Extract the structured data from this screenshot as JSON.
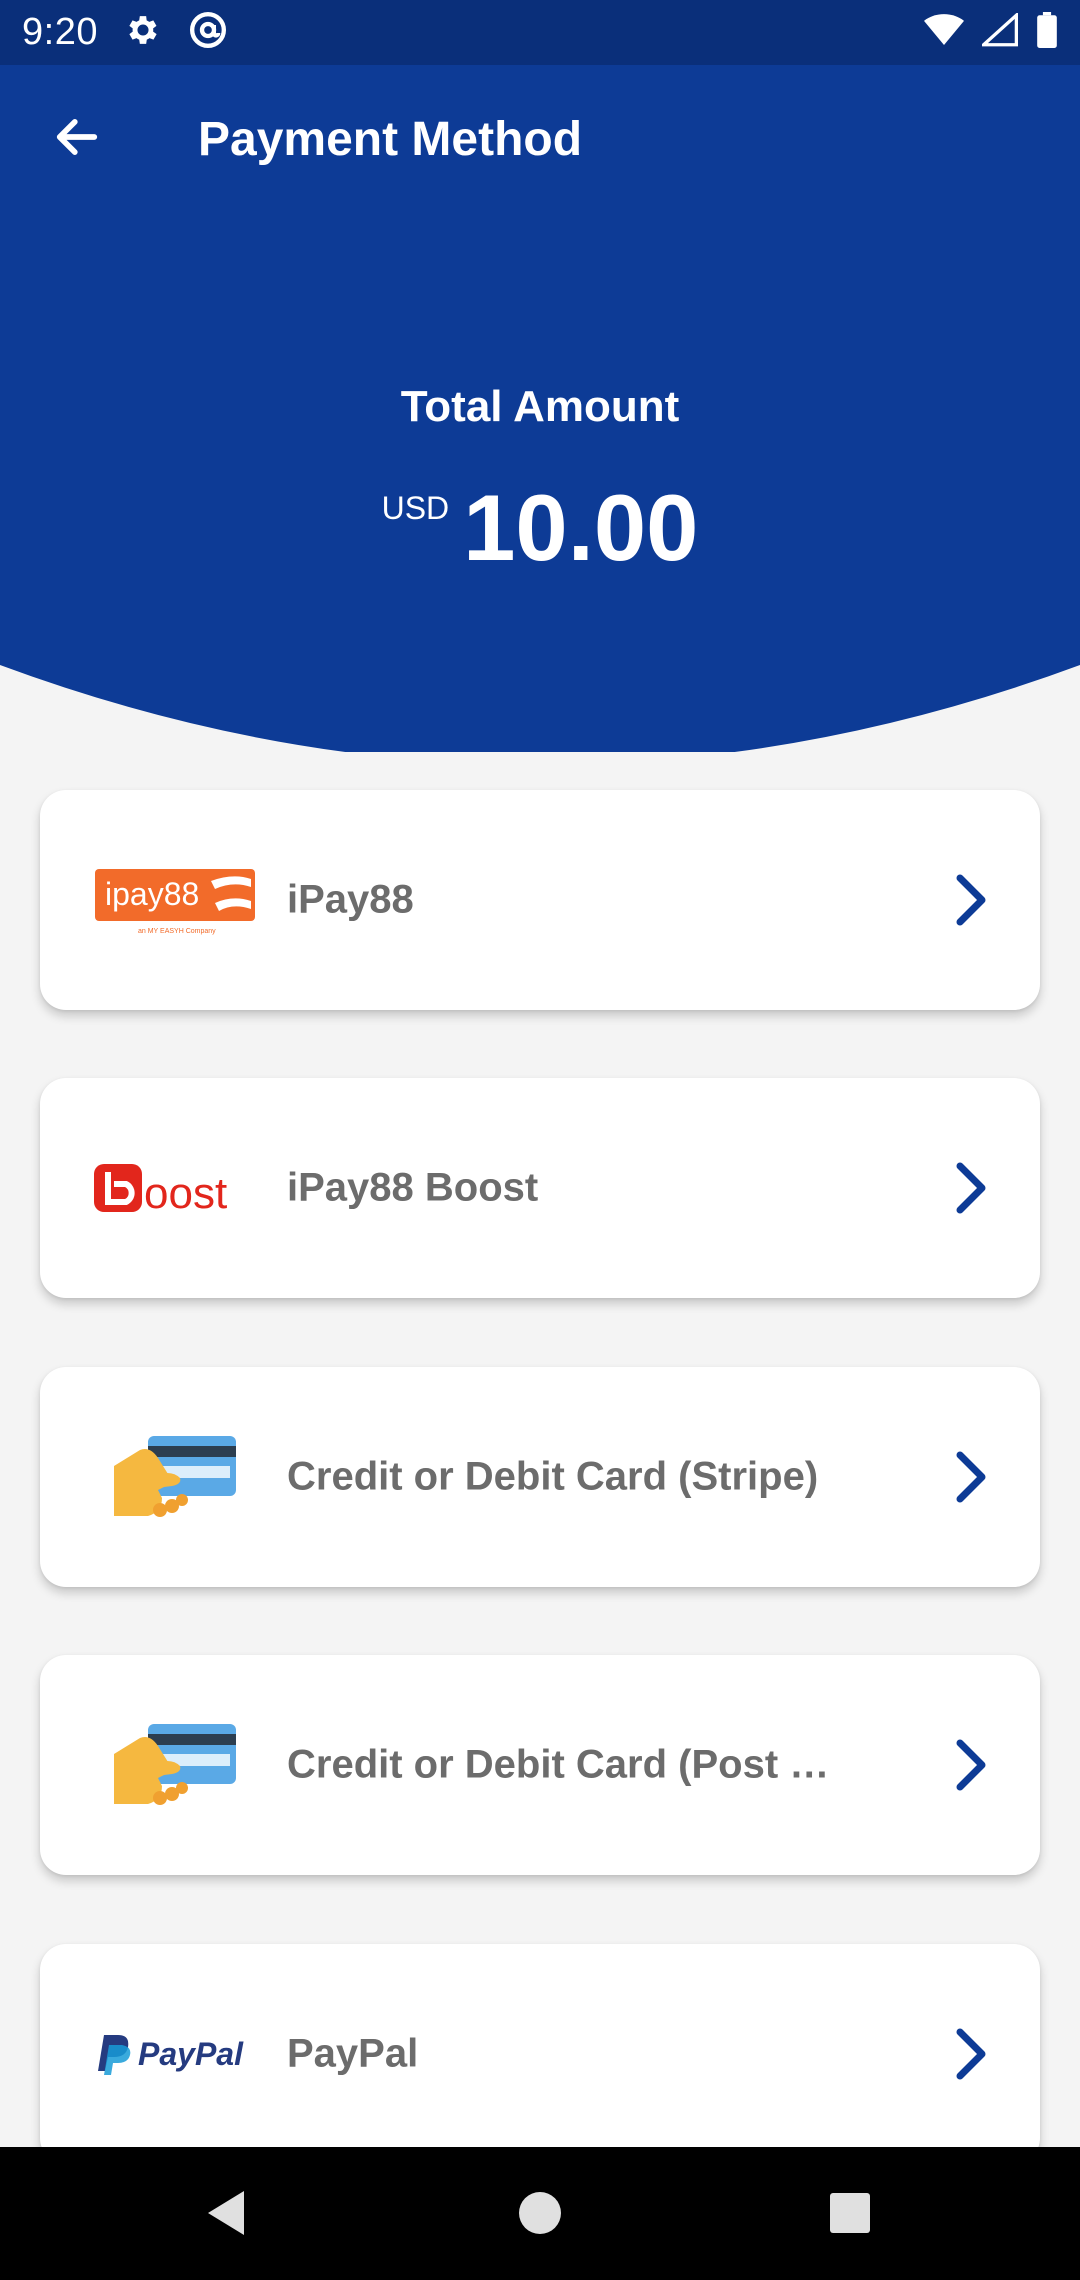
{
  "status_bar": {
    "time": "9:20",
    "icons_left": [
      "gear-icon",
      "at-sign-icon"
    ],
    "icons_right": [
      "wifi-icon",
      "cellular-signal-icon",
      "battery-icon"
    ]
  },
  "app_bar": {
    "title": "Payment Method",
    "back_icon": "arrow-left-icon"
  },
  "summary": {
    "label": "Total Amount",
    "currency": "USD",
    "amount": "10.00"
  },
  "payment_methods": [
    {
      "label": "iPay88",
      "logo": "ipay88-logo",
      "logo_text": "ipay88",
      "logo_subtext": "an MY EASYH Company"
    },
    {
      "label": "iPay88 Boost",
      "logo": "boost-logo",
      "logo_text": "oost"
    },
    {
      "label": "Credit or Debit Card (Stripe)",
      "logo": "card-in-hand-icon"
    },
    {
      "label": "Credit or Debit Card (Post …",
      "logo": "card-in-hand-icon"
    },
    {
      "label": "PayPal",
      "logo": "paypal-logo",
      "logo_text": "PayPal"
    }
  ],
  "nav_bar": {
    "icons": [
      "back-triangle-icon",
      "home-circle-icon",
      "recents-square-icon"
    ]
  },
  "colors": {
    "primary": "#0d3b96",
    "status_bar": "#0a2f7a",
    "background": "#f4f4f4",
    "label_gray": "#6c6c6c",
    "chevron": "#0d3b96",
    "ipay88_orange": "#f26b2a",
    "boost_red": "#e2261c",
    "paypal_dark": "#253b80",
    "paypal_light": "#179bd7"
  }
}
